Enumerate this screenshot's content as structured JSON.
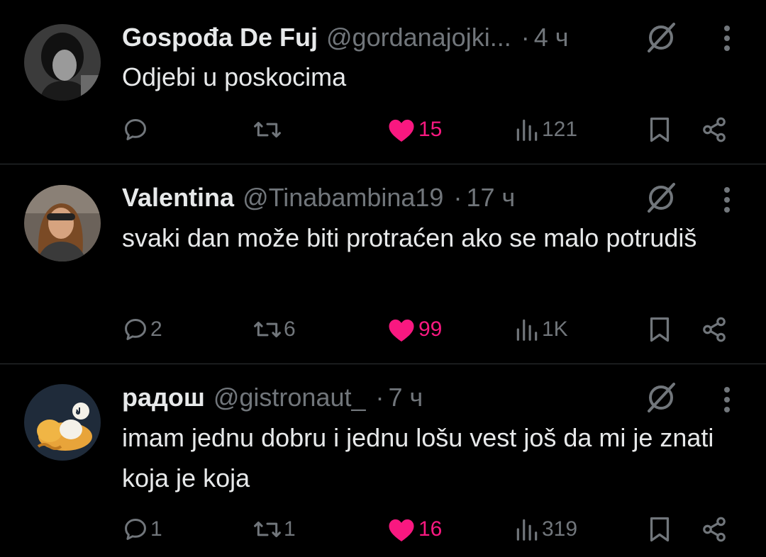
{
  "tweets": [
    {
      "name": "Gospođa De Fuj",
      "handle": "@gordanajojki...",
      "dot": "·",
      "time": "4 ч",
      "text": "Odjebi u poskocima",
      "replies": "",
      "reposts": "",
      "likes": "15",
      "views": "121",
      "liked": true
    },
    {
      "name": "Valentina",
      "handle": "@Tinabambina19",
      "dot": "·",
      "time": "17 ч",
      "text": "svaki dan može biti protraćen ako se malo potrudiš",
      "replies": "2",
      "reposts": "6",
      "likes": "99",
      "views": "1K",
      "liked": true
    },
    {
      "name": "радош",
      "handle": "@gistronaut_",
      "dot": "·",
      "time": "7 ч",
      "text": "imam jednu dobru i jednu lošu vest još da mi je znati koja je koja",
      "replies": "1",
      "reposts": "1",
      "likes": "16",
      "views": "319",
      "liked": true
    }
  ],
  "icons": {
    "reply": "reply-icon",
    "repost": "repost-icon",
    "like": "heart-icon",
    "views": "views-icon",
    "bookmark": "bookmark-icon",
    "share": "share-icon",
    "grok": "grok-icon",
    "more": "more-icon"
  },
  "colors": {
    "background": "#000000",
    "text": "#e7e9ea",
    "muted": "#71767b",
    "like": "#f91880",
    "divider": "#2f3336"
  }
}
